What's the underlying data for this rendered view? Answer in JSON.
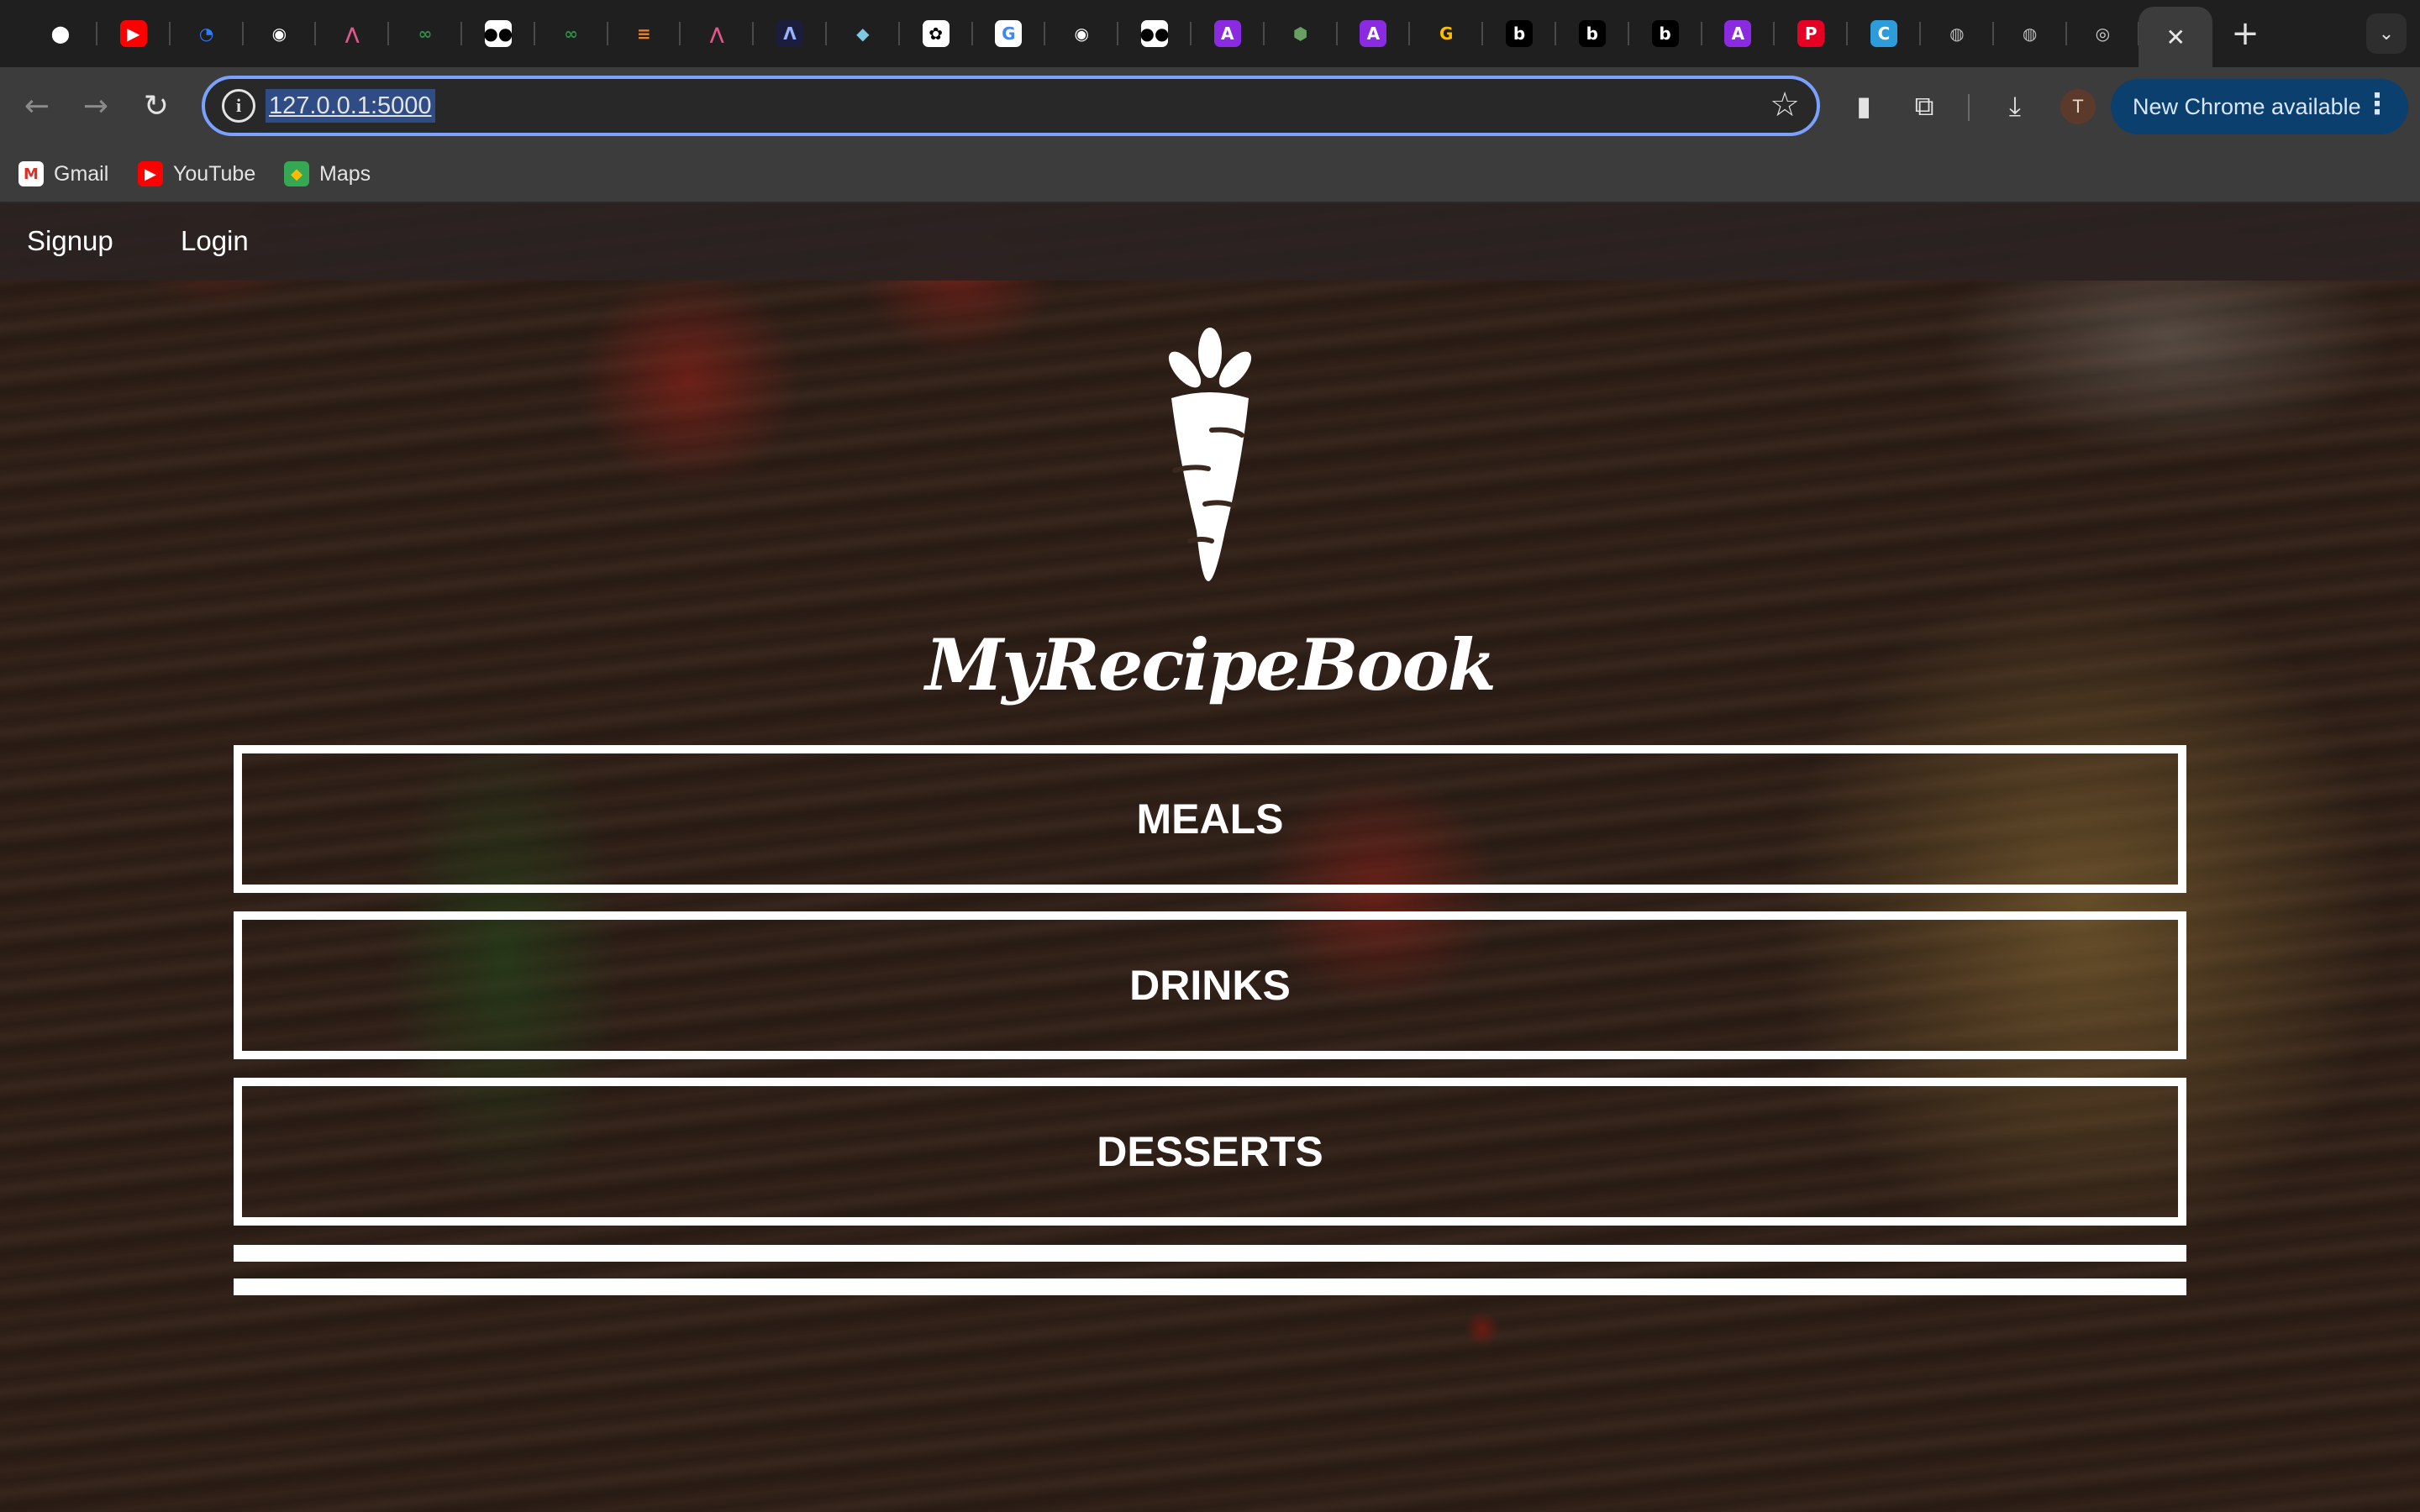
{
  "browser": {
    "tabs": [
      {
        "icon": "github-icon",
        "glyph": "⬤",
        "bg": "transparent",
        "fg": "#ffffff"
      },
      {
        "icon": "youtube-icon",
        "glyph": "▶",
        "bg": "#ff0000",
        "fg": "#ffffff"
      },
      {
        "icon": "digitalocean-icon",
        "glyph": "◔",
        "bg": "transparent",
        "fg": "#2f7cff"
      },
      {
        "icon": "copilot-icon",
        "glyph": "◉",
        "bg": "transparent",
        "fg": "#ffffff"
      },
      {
        "icon": "replit-icon",
        "glyph": "⋀",
        "bg": "transparent",
        "fg": "#e2568e"
      },
      {
        "icon": "geeksforgeeks-icon",
        "glyph": "∞",
        "bg": "transparent",
        "fg": "#2f8d46"
      },
      {
        "icon": "medium-icon",
        "glyph": "●●",
        "bg": "#ffffff",
        "fg": "#000000"
      },
      {
        "icon": "geeksforgeeks-icon",
        "glyph": "∞",
        "bg": "transparent",
        "fg": "#2f8d46"
      },
      {
        "icon": "stackoverflow-icon",
        "glyph": "≡",
        "bg": "transparent",
        "fg": "#f48024"
      },
      {
        "icon": "replit-icon",
        "glyph": "⋀",
        "bg": "transparent",
        "fg": "#e2568e"
      },
      {
        "icon": "react-devtools-icon",
        "glyph": "Λ",
        "bg": "#1c1c3c",
        "fg": "#9ab3ff"
      },
      {
        "icon": "cube-icon",
        "glyph": "◆",
        "bg": "transparent",
        "fg": "#7ec8e3"
      },
      {
        "icon": "openai-icon",
        "glyph": "✿",
        "bg": "#ffffff",
        "fg": "#000000"
      },
      {
        "icon": "google-icon",
        "glyph": "G",
        "bg": "#ffffff",
        "fg": "#4285f4"
      },
      {
        "icon": "copilot-icon",
        "glyph": "◉",
        "bg": "transparent",
        "fg": "#ffffff"
      },
      {
        "icon": "medium-icon",
        "glyph": "●●",
        "bg": "#ffffff",
        "fg": "#000000"
      },
      {
        "icon": "angular-icon",
        "glyph": "A",
        "bg": "#8a2be2",
        "fg": "#ffffff"
      },
      {
        "icon": "nodejs-icon",
        "glyph": "⬢",
        "bg": "transparent",
        "fg": "#68a063"
      },
      {
        "icon": "angular-icon",
        "glyph": "A",
        "bg": "#8a2be2",
        "fg": "#ffffff"
      },
      {
        "icon": "google-cloud-icon",
        "glyph": "G",
        "bg": "transparent",
        "fg": "#fbbc05"
      },
      {
        "icon": "bold-b-icon",
        "glyph": "b",
        "bg": "#000000",
        "fg": "#ffffff"
      },
      {
        "icon": "bold-b-icon",
        "glyph": "b",
        "bg": "#000000",
        "fg": "#ffffff"
      },
      {
        "icon": "bold-b-icon",
        "glyph": "b",
        "bg": "#000000",
        "fg": "#ffffff"
      },
      {
        "icon": "angular-icon",
        "glyph": "A",
        "bg": "#8a2be2",
        "fg": "#ffffff"
      },
      {
        "icon": "pinterest-icon",
        "glyph": "P",
        "bg": "#e60023",
        "fg": "#ffffff"
      },
      {
        "icon": "canva-icon",
        "glyph": "C",
        "bg": "#2d9cdb",
        "fg": "#ffffff"
      },
      {
        "icon": "globe-icon",
        "glyph": "◍",
        "bg": "transparent",
        "fg": "#bdbdbd"
      },
      {
        "icon": "globe-icon",
        "glyph": "◍",
        "bg": "transparent",
        "fg": "#bdbdbd"
      },
      {
        "icon": "chrome-icon",
        "glyph": "◎",
        "bg": "transparent",
        "fg": "#d0d0d0"
      },
      {
        "icon": "close-icon",
        "glyph": "✕",
        "bg": "transparent",
        "fg": "#e8e8e8",
        "active": true
      }
    ],
    "address": {
      "url": "127.0.0.1:5000"
    },
    "update_label": "New Chrome available",
    "profile_initial": "T",
    "bookmarks": [
      {
        "label": "Gmail",
        "icon": "gmail-icon",
        "glyph": "M",
        "bg": "#ffffff",
        "fg": "#d93025"
      },
      {
        "label": "YouTube",
        "icon": "youtube-icon",
        "glyph": "▶",
        "bg": "#ff0000",
        "fg": "#ffffff"
      },
      {
        "label": "Maps",
        "icon": "maps-icon",
        "glyph": "◆",
        "bg": "#34a853",
        "fg": "#fbbc05"
      }
    ]
  },
  "site": {
    "nav": {
      "signup": "Signup",
      "login": "Login"
    },
    "brand": "MyRecipeBook",
    "categories": {
      "meals": "MEALS",
      "drinks": "DRINKS",
      "desserts": "DESSERTS"
    }
  }
}
